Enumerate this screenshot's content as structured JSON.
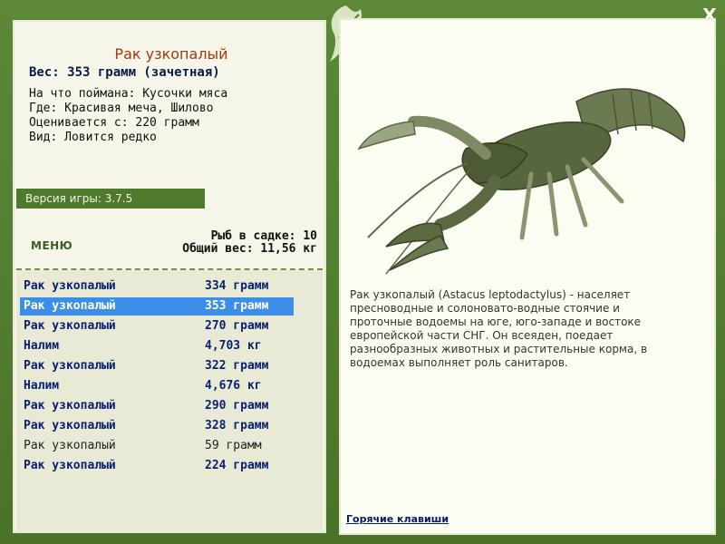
{
  "header": {
    "close_label": "X"
  },
  "fish": {
    "title": "Рак узкопалый",
    "weight": "Вес: 353 грамм (зачетная)",
    "bait": "На что поймана: Кусочки мяса",
    "location": "Где: Красивая меча, Шилово",
    "valued_from": "Оценивается с: 220 грамм",
    "rarity": "Вид: Ловится редко"
  },
  "version": "Версия игры: 3.7.5",
  "menu_label": "МЕНЮ",
  "stats": {
    "fish_count": "Рыб в садке: 10",
    "total_weight": "Общий вес: 11,56 кг"
  },
  "catch_list": [
    {
      "name": "Рак узкопалый",
      "weight": "334 грамм"
    },
    {
      "name": "Рак узкопалый",
      "weight": "353 грамм"
    },
    {
      "name": "Рак узкопалый",
      "weight": "270 грамм"
    },
    {
      "name": "Налим",
      "weight": "4,703 кг"
    },
    {
      "name": "Рак узкопалый",
      "weight": "322 грамм"
    },
    {
      "name": "Налим",
      "weight": "4,676 кг"
    },
    {
      "name": "Рак узкопалый",
      "weight": "290 грамм"
    },
    {
      "name": "Рак узкопалый",
      "weight": "328 грамм"
    },
    {
      "name": "Рак узкопалый",
      "weight": "59 грамм"
    },
    {
      "name": "Рак узкопалый",
      "weight": "224 грамм"
    }
  ],
  "description": "Рак узкопалый (Astacus leptodactylus) - населяет пресноводные и солоновато-водные стоячие и проточные водоемы на юге, юго-западе и востоке европейской части СНГ. Он всеяден, поедает разнообразных животных и растительные корма, в водоемах выполняет роль санитаров.",
  "hotkeys_label": "Горячие клавиши",
  "colors": {
    "frame": "#4f7a2e",
    "selected_row": "#3c8ee8",
    "title": "#a23a10"
  },
  "icons": [
    "leaf-logo-icon",
    "close-icon",
    "crayfish-image"
  ]
}
